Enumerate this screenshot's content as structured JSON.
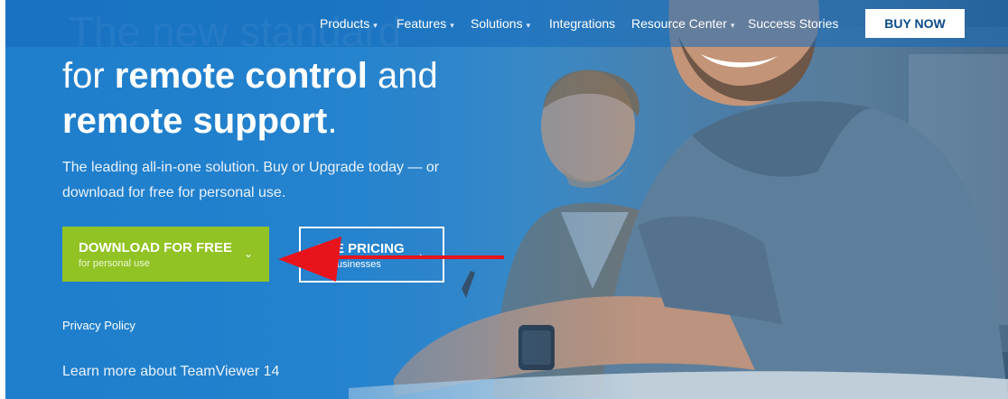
{
  "nav": {
    "items": [
      {
        "label": "Products",
        "caret": "▾"
      },
      {
        "label": "Features",
        "caret": "▾"
      },
      {
        "label": "Solutions",
        "caret": "▾"
      },
      {
        "label": "Integrations",
        "caret": ""
      },
      {
        "label": "Resource Center",
        "caret": "▾"
      },
      {
        "label": "Success Stories",
        "caret": ""
      }
    ],
    "buy_label": "BUY NOW"
  },
  "hero": {
    "ghost": "The new standard",
    "line1_a": "for ",
    "line1_b": "remote control",
    "line1_c": " and",
    "line2_b": "remote support",
    "line2_c": ".",
    "lead": "The leading all-in-one solution. Buy or Upgrade today — or download for free for personal use."
  },
  "download": {
    "title": "DOWNLOAD FOR FREE",
    "sub": "for personal use",
    "chevron": "⌄"
  },
  "pricing": {
    "title": "SEE PRICING",
    "sub": "for businesses",
    "chevron": "›"
  },
  "privacy": "Privacy Policy",
  "learn": "Learn more about TeamViewer 14",
  "colors": {
    "brand_blue": "#1f7fcc",
    "download_green": "#92c324",
    "annotation_red": "#e8141c"
  },
  "icons": {
    "dropdown": "chevron-down-icon",
    "next": "chevron-right-icon",
    "annotation": "arrow-left-icon"
  }
}
